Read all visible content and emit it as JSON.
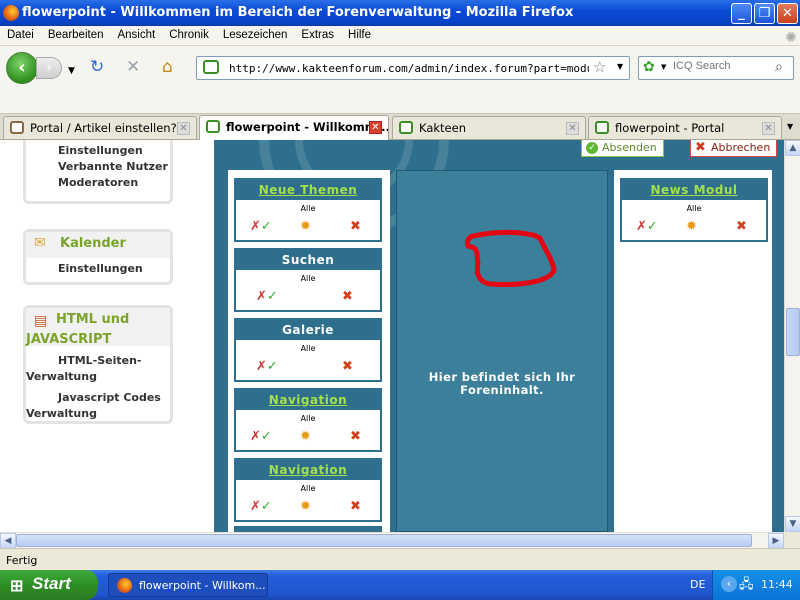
{
  "window": {
    "title": "flowerpoint - Willkommen im Bereich der Forenverwaltung - Mozilla Firefox"
  },
  "menu": [
    "Datei",
    "Bearbeiten",
    "Ansicht",
    "Chronik",
    "Lesezeichen",
    "Extras",
    "Hilfe"
  ],
  "nav": {
    "url": "http://www.kakteenforum.com/admin/index.forum?part=modules&sub=po",
    "search_placeholder": "ICQ Search"
  },
  "tabs": [
    {
      "label": "Portal / Artikel einstellen?"
    },
    {
      "label": "flowerpoint - Willkomm..."
    },
    {
      "label": "Kakteen"
    },
    {
      "label": "flowerpoint - Portal"
    }
  ],
  "sidebar": {
    "panel1": [
      "Einstellungen",
      "Verbannte Nutzer",
      "Moderatoren"
    ],
    "calendar": {
      "title": "Kalender",
      "items": [
        "Einstellungen"
      ]
    },
    "html": {
      "title": "HTML und JAVASCRIPT",
      "items": [
        "HTML-Seiten-Verwaltung",
        "Javascript Codes Verwaltung"
      ]
    }
  },
  "actions": {
    "submit": "Absenden",
    "cancel": "Abbrechen"
  },
  "modules_left": [
    {
      "title": "Neue Themen",
      "sub": "Alle",
      "link": true,
      "edit": true
    },
    {
      "title": "Suchen",
      "sub": "Alle",
      "link": false,
      "edit": false
    },
    {
      "title": "Galerie",
      "sub": "Alle",
      "link": false,
      "edit": false
    },
    {
      "title": "Navigation",
      "sub": "Alle",
      "link": true,
      "edit": true
    },
    {
      "title": "Navigation",
      "sub": "Alle",
      "link": true,
      "edit": true
    }
  ],
  "modules_right": [
    {
      "title": "News Modul",
      "sub": "Alle",
      "link": true,
      "edit": true
    }
  ],
  "center": {
    "text": "Hier befindet sich Ihr Foreninhalt."
  },
  "status": {
    "text": "Fertig"
  },
  "taskbar": {
    "start": "Start",
    "item": "flowerpoint - Willkom...",
    "lang": "DE",
    "time": "11:44"
  },
  "colors": {
    "accent": "#2d6f8c",
    "link_green": "#a4e04a",
    "annotation": "#e30613"
  }
}
